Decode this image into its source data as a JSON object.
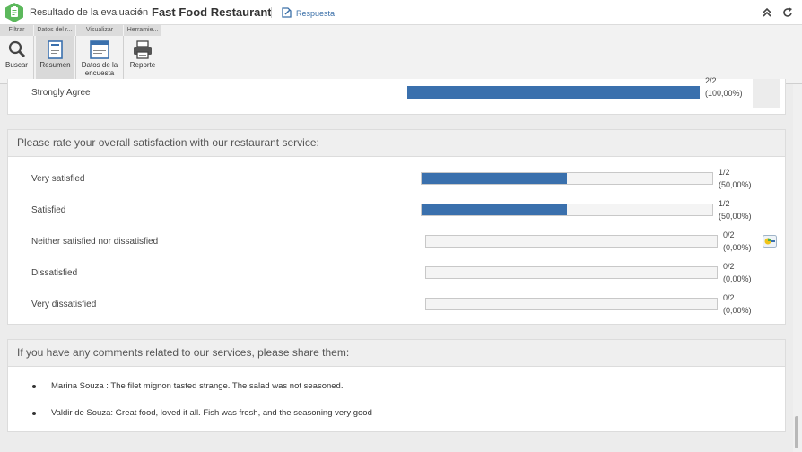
{
  "header": {
    "breadcrumb": "Resultado de la evaluación",
    "title": "Fast Food Restaurant",
    "mode_label": "Respuesta"
  },
  "toolbar": {
    "groups": [
      "Filtrar",
      "Datos del r...",
      "Visualizar",
      "Herramie..."
    ],
    "buttons": {
      "search": "Buscar",
      "summary": "Resumen",
      "survey_data_1": "Datos de la",
      "survey_data_2": "encuesta",
      "report": "Reporte"
    }
  },
  "prev_question": {
    "row": {
      "label": "Strongly Agree",
      "count": "2/2",
      "pct": "(100,00%)",
      "fraction": 1.0
    }
  },
  "satisfaction": {
    "title": "Please rate your overall satisfaction with our restaurant service:",
    "rows": [
      {
        "label": "Very satisfied",
        "count": "1/2",
        "pct": "(50,00%)",
        "fraction": 0.5
      },
      {
        "label": "Satisfied",
        "count": "1/2",
        "pct": "(50,00%)",
        "fraction": 0.5
      },
      {
        "label": "Neither satisfied nor dissatisfied",
        "count": "0/2",
        "pct": "(0,00%)",
        "fraction": 0
      },
      {
        "label": "Dissatisfied",
        "count": "0/2",
        "pct": "(0,00%)",
        "fraction": 0
      },
      {
        "label": "Very dissatisfied",
        "count": "0/2",
        "pct": "(0,00%)",
        "fraction": 0
      }
    ]
  },
  "comments": {
    "title": "If you have any comments related to our services, please share them:",
    "items": [
      "Marina Souza : The filet mignon tasted strange. The salad was not seasoned.",
      "Valdir de Souza: Great food, loved it all. Fish was fresh, and the seasoning very good"
    ]
  },
  "colors": {
    "accent": "#3a70ad",
    "logo": "#5cb85c"
  }
}
